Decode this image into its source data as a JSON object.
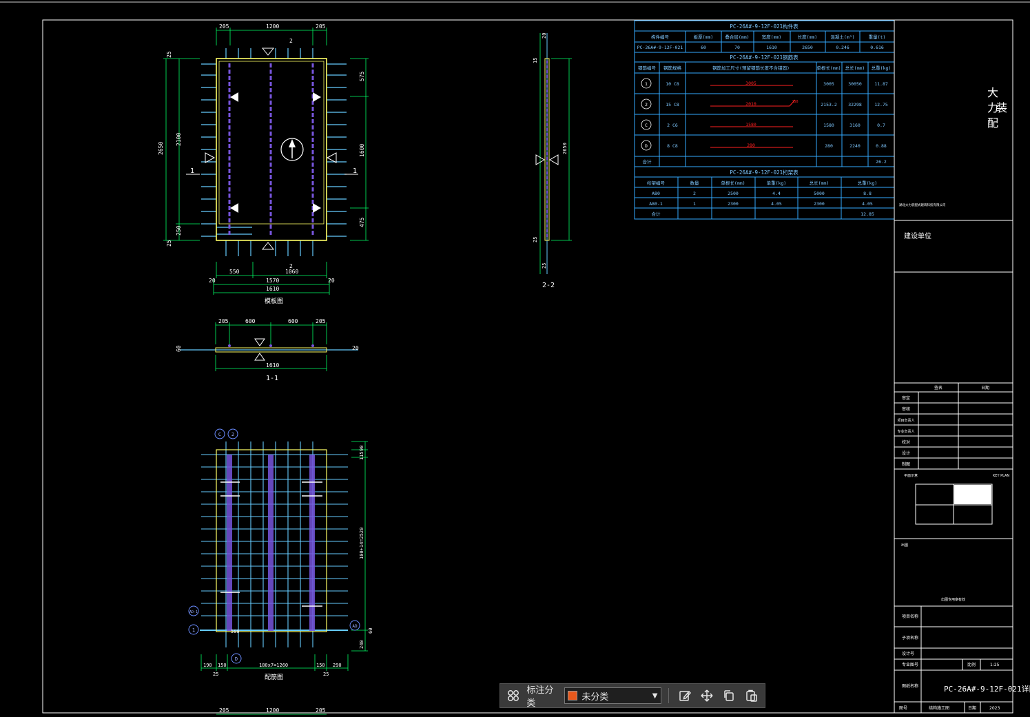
{
  "drawing": {
    "elevation_view": {
      "top_dims": [
        "205",
        "1200",
        "205"
      ],
      "left_dims_outer": "2650",
      "left_dims_inner": "2100",
      "left_small": [
        "25",
        "250",
        "25"
      ],
      "right_dims": [
        "575",
        "1600",
        "475"
      ],
      "bottom_dims": [
        "550",
        "1060"
      ],
      "bottom_total": [
        "20",
        "1570",
        "20"
      ],
      "bottom_overall": "1610",
      "section_marks": [
        "1",
        "1",
        "2",
        "2"
      ],
      "caption": "模板图"
    },
    "section_1_1": {
      "top_dims": [
        "205",
        "600",
        "600",
        "205"
      ],
      "side_labels": [
        "60",
        "20"
      ],
      "bottom_dim": "1610",
      "caption": "1-1"
    },
    "section_2_2": {
      "labels": [
        "20",
        "15",
        "25",
        "25",
        "20"
      ],
      "right_dim": "2650",
      "caption": "2-2"
    },
    "reinforcement_view": {
      "circle_tags": [
        "C",
        "2",
        "AD-1",
        "1",
        "AD",
        "D"
      ],
      "right_dims": [
        "90",
        "115",
        "100+14=2520",
        "240",
        "60"
      ],
      "bottom_dims": [
        "190",
        "150",
        "180x7=1260",
        "150",
        "290"
      ],
      "bottom_small": [
        "25",
        "25"
      ],
      "mid_label": "500",
      "caption": "配筋图"
    },
    "table_panel": {
      "prop_title": "PC-26A#-9-12F-021构件表",
      "prop_headers": [
        "构件编号",
        "板厚(mm)",
        "叠合层(mm)",
        "宽度(mm)",
        "长度(mm)",
        "混凝土(m³)",
        "重量(t)"
      ],
      "prop_row": [
        "PC-26A#-9-12F-021",
        "60",
        "70",
        "1610",
        "2650",
        "0.246",
        "0.616"
      ],
      "rebar_title": "PC-26A#-9-12F-021钢筋表",
      "rebar_headers": [
        "钢筋编号",
        "钢筋规格",
        "钢筋加工尺寸(预留钢筋长度不含锚固)",
        "单根长(mm)",
        "总长(mm)",
        "总重(kg)"
      ],
      "rebar_rows": [
        {
          "id": "1",
          "spec": "10 C8",
          "shape": "3005",
          "single": "3005",
          "total": "30050",
          "weight": "11.87"
        },
        {
          "id": "2",
          "spec": "15 C8",
          "shape": "2010",
          "single": "2153.2",
          "total": "32298",
          "weight": "12.75"
        },
        {
          "id": "C",
          "spec": "2 C6",
          "shape": "1580",
          "single": "1580",
          "total": "3160",
          "weight": "0.7"
        },
        {
          "id": "D",
          "spec": "8 C8",
          "shape": "280",
          "single": "280",
          "total": "2240",
          "weight": "0.88"
        }
      ],
      "rebar_total_label": "合计",
      "rebar_total": "26.2",
      "shape_hook": "150",
      "truss_title": "PC-26A#-9-12F-021桁架表",
      "truss_headers": [
        "桁架编号",
        "数量",
        "单根长(mm)",
        "单重(kg)",
        "总长(mm)",
        "总重(kg)"
      ],
      "truss_rows": [
        [
          "A80",
          "2",
          "2500",
          "4.4",
          "5000",
          "8.8"
        ],
        [
          "A80-1",
          "1",
          "2300",
          "4.05",
          "2300",
          "4.05"
        ]
      ],
      "truss_total_label": "合计",
      "truss_total": "12.85"
    },
    "title_block": {
      "logo_chars": [
        "大",
        "力",
        "装",
        "配"
      ],
      "company_small": "湖北大力装配式建筑科技有限公司",
      "client_label": "建设单位",
      "sign_headers": [
        "签名",
        "日期"
      ],
      "sign_rows": [
        "审定",
        "审核",
        "项目负责人",
        "专业负责人",
        "校对",
        "设计",
        "制图"
      ],
      "keyplan_left": "平面示意",
      "keyplan_right": "KEY PLAN",
      "stamp_label": "出图",
      "stamp_center": "出图专用章有效",
      "info_rows": [
        "项目名称",
        "子项名称",
        "设计号",
        "专业图号"
      ],
      "scale_label": "比例",
      "scale_value": "1:25",
      "drawing_name_label": "图纸名称",
      "drawing_name": "PC-26A#-9-12F-021详图",
      "date_label": "日期",
      "date_value": "2023",
      "sheet_label": "图号",
      "sheet_value": "结构施工图"
    }
  },
  "toolbar": {
    "grid_icon": "grid-icon",
    "category_label": "标注分类",
    "select_value": "未分类",
    "select_color": "#e8581c",
    "tools": [
      "edit-icon",
      "move-icon",
      "copy-icon",
      "paste-icon"
    ]
  },
  "colors": {
    "bg": "#000000",
    "frame": "#ffffff",
    "dim": "#00ff66",
    "concrete": "#ffff66",
    "rebar": "#66ccff",
    "truss": "#7755dd",
    "table": "#33aaff",
    "shape_red": "#ff2020"
  }
}
